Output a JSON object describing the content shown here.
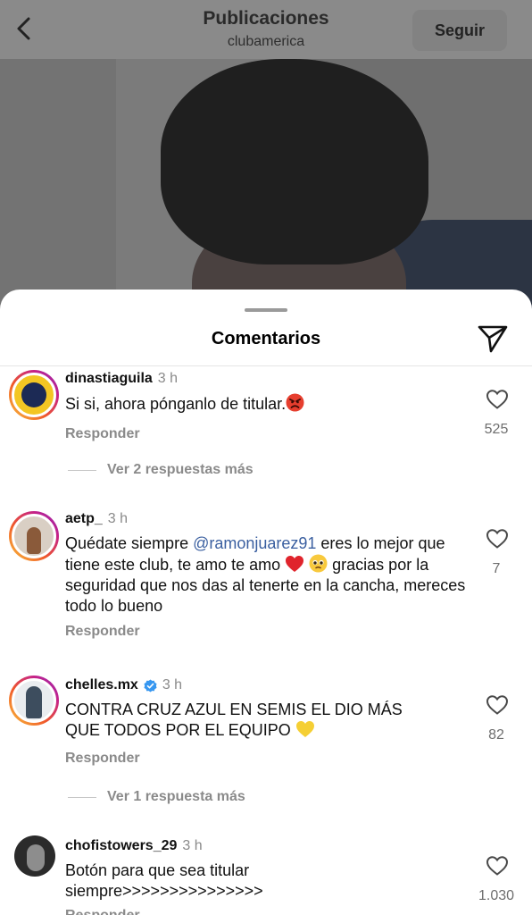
{
  "header": {
    "title": "Publicaciones",
    "subtitle": "clubamerica",
    "follow_label": "Seguir"
  },
  "sheet": {
    "title": "Comentarios"
  },
  "comments": [
    {
      "username": "dinastiaguila",
      "time": "3 h",
      "text": "Si si, ahora pónganlo de titular.",
      "emoji": "angry-face",
      "reply_label": "Responder",
      "likes": "525",
      "view_replies": "Ver 2 respuestas más"
    },
    {
      "username": "aetp_",
      "time": "3 h",
      "text_before": "Quédate siempre ",
      "mention": "@ramonjuarez91",
      "text_after_1": " eres lo mejor que tiene este club, te amo te amo ",
      "text_after_2": " gracias por la seguridad que nos das al tenerte en la cancha, mereces todo lo bueno",
      "emojis": [
        "red-heart",
        "pleading-face"
      ],
      "reply_label": "Responder",
      "likes": "7"
    },
    {
      "username": "chelles.mx",
      "verified": true,
      "time": "3 h",
      "text": "CONTRA CRUZ AZUL EN SEMIS EL DIO MÁS QUE TODOS POR EL EQUIPO ",
      "emoji": "yellow-heart",
      "reply_label": "Responder",
      "likes": "82",
      "view_replies": "Ver 1 respuesta más"
    },
    {
      "username": "chofistowers_29",
      "time": "3 h",
      "text": "Botón para que sea titular siempre>>>>>>>>>>>>>>>",
      "reply_label": "Responder",
      "likes": "1.030"
    }
  ],
  "colors": {
    "mention": "#3a5fa0",
    "muted": "#8a8a8a",
    "story_ring": [
      "#f9c23c",
      "#f0592a",
      "#c4218a",
      "#8e2bb6"
    ],
    "verified": "#3797f0"
  }
}
